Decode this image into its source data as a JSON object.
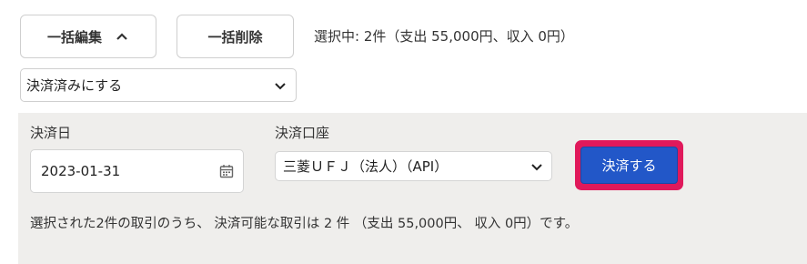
{
  "toolbar": {
    "bulk_edit_label": "一括編集",
    "bulk_delete_label": "一括削除",
    "selection_info": "選択中: 2件（支出 55,000円、収入 0円）"
  },
  "action_select": {
    "selected": "決済済みにする"
  },
  "settle_panel": {
    "date_label": "決済日",
    "date_value": "2023-01-31",
    "account_label": "決済口座",
    "account_value": "三菱ＵＦＪ（法人）（API）",
    "settle_button_label": "決済する",
    "summary": "選択された2件の取引のうち、 決済可能な取引は 2 件 （支出 55,000円、 収入 0円）です。"
  },
  "colors": {
    "primary_button": "#2257c8",
    "focus_ring": "#e0195b",
    "panel_bg": "#efeeec"
  },
  "icons": [
    "chevron-up-icon",
    "chevron-down-icon",
    "calendar-icon"
  ]
}
